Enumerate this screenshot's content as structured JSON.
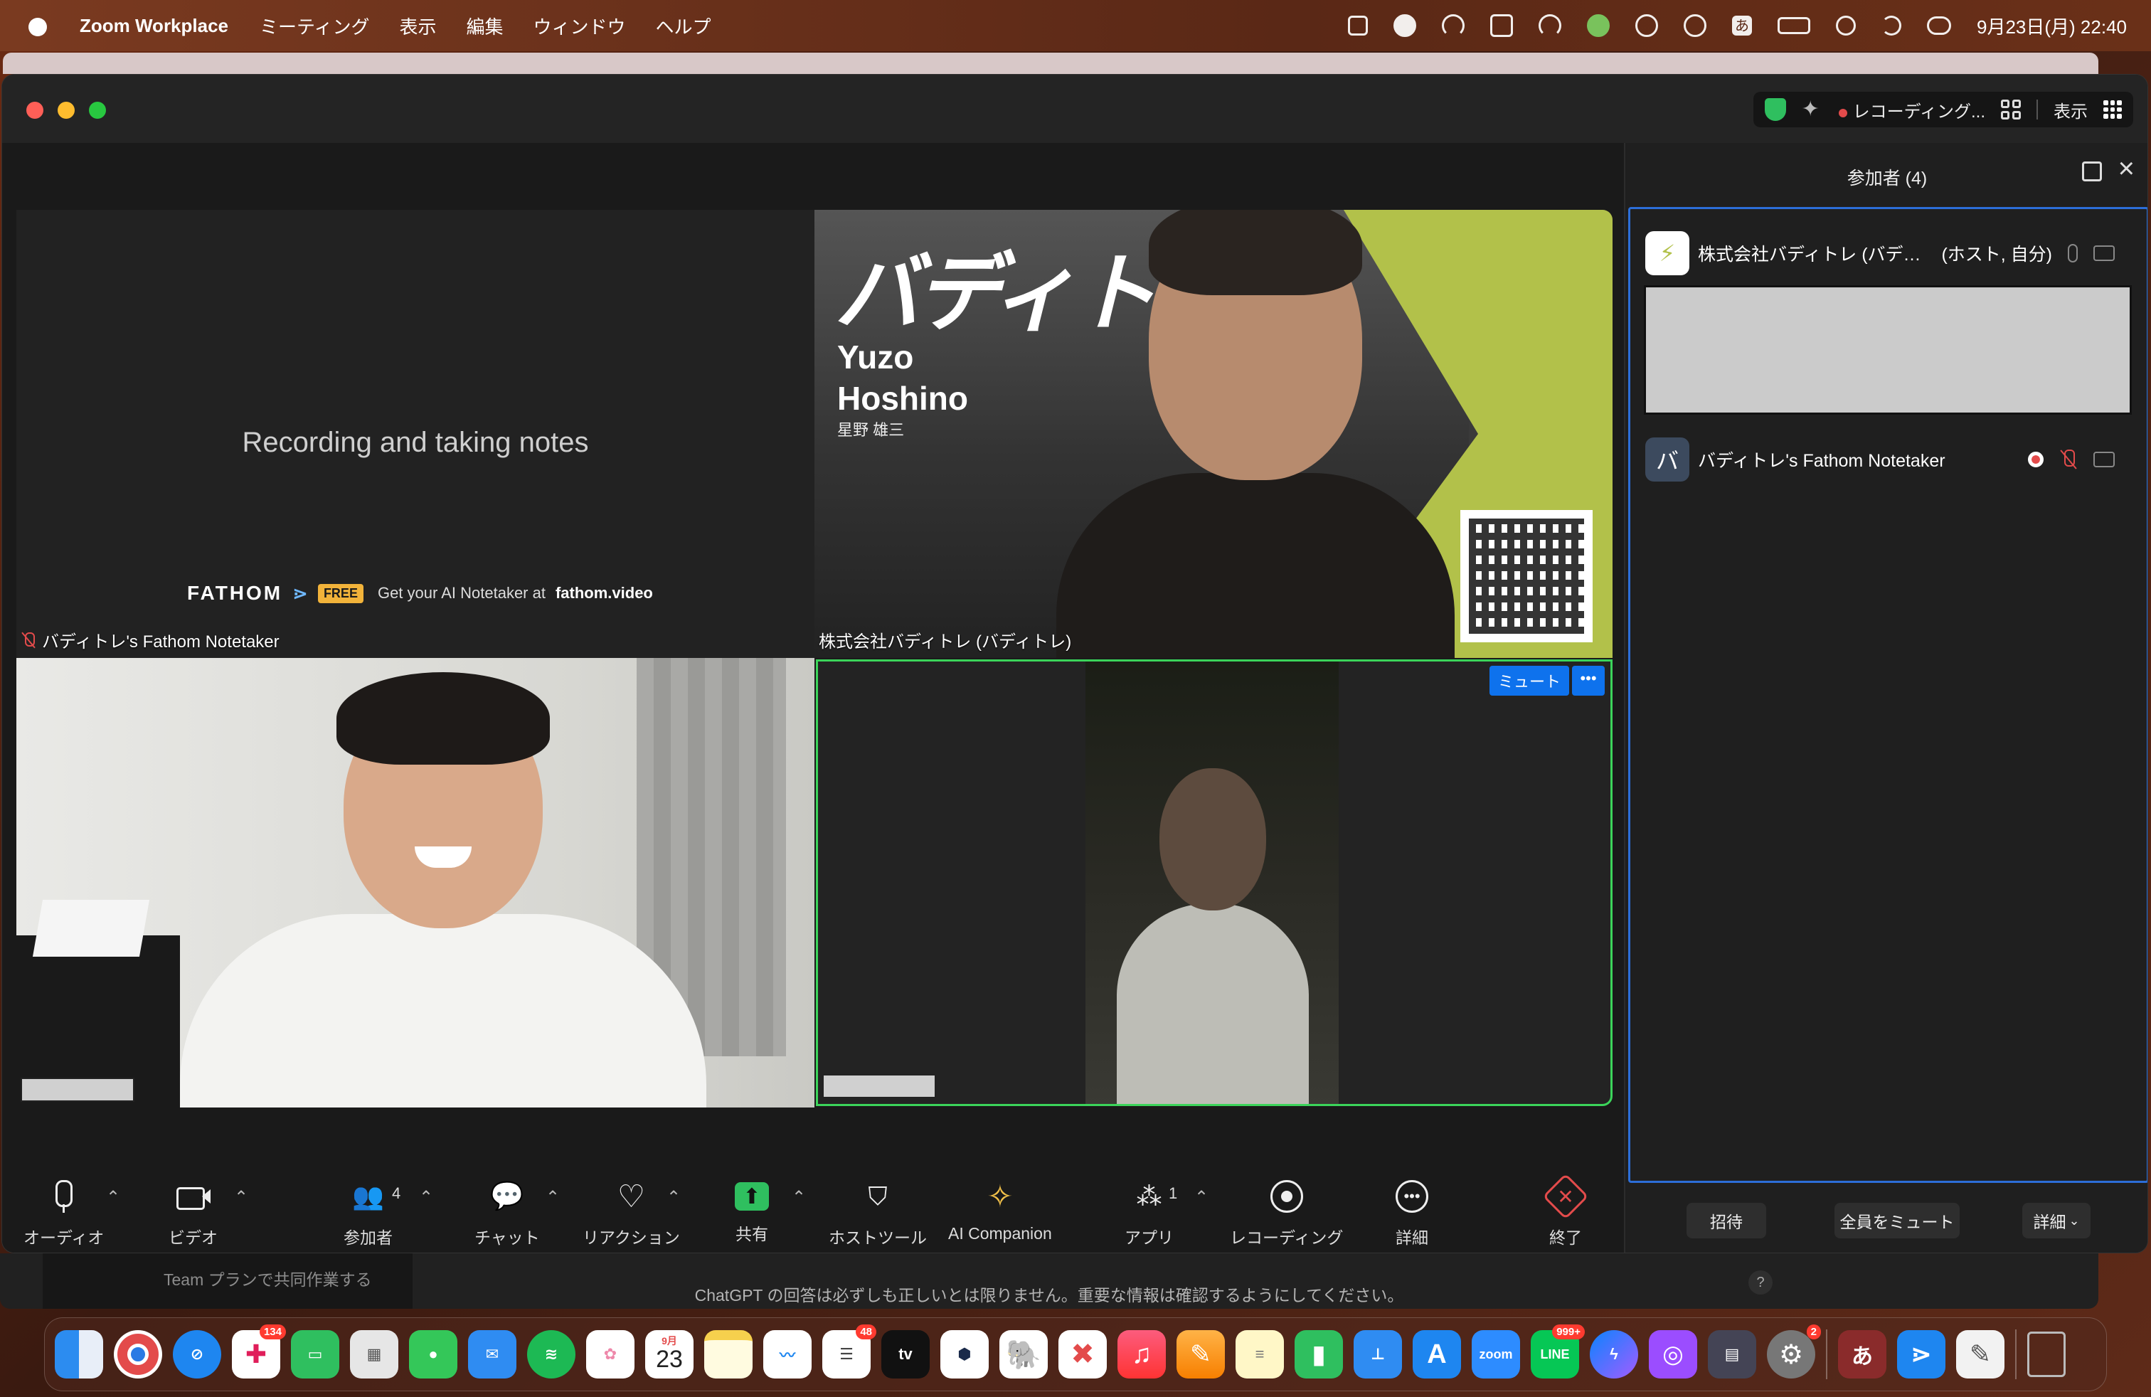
{
  "menubar": {
    "app_name": "Zoom Workplace",
    "menus": [
      "ミーティング",
      "表示",
      "編集",
      "ウィンドウ",
      "ヘルプ"
    ],
    "input_method": "あ",
    "clock": "9月23日(月) 22:40"
  },
  "titlebar": {
    "recording_label": "レコーディング...",
    "view_label": "表示"
  },
  "tiles": {
    "fathom": {
      "message": "Recording and taking notes",
      "logo": "FATHOM",
      "free_badge": "FREE",
      "promo_prefix": "Get your AI Notetaker at",
      "promo_link": "fathom.video",
      "name": "バディトレ's Fathom Notetaker"
    },
    "host": {
      "brand": "バディトレ",
      "display_name_line1": "Yuzo",
      "display_name_line2": "Hoshino",
      "display_name_jp": "星野 雄三",
      "name": "株式会社バディトレ (バディトレ)"
    },
    "active": {
      "mute_label": "ミュート",
      "more_label": "•••"
    }
  },
  "toolbar": {
    "audio": "オーディオ",
    "video": "ビデオ",
    "participants": "参加者",
    "participants_count": "4",
    "chat": "チャット",
    "reactions": "リアクション",
    "share": "共有",
    "host_tools": "ホストツール",
    "ai_companion": "AI Companion",
    "apps": "アプリ",
    "apps_count": "1",
    "recording": "レコーディング",
    "more": "詳細",
    "end": "終了"
  },
  "panel": {
    "title": "参加者 (4)",
    "participants": [
      {
        "name": "株式会社バディトレ (バデ…",
        "role": "(ホスト, 自分)",
        "avatar": "⚡"
      },
      {
        "name": "バディトレ's Fathom Notetaker",
        "role": "",
        "avatar": "バ"
      }
    ],
    "invite": "招待",
    "mute_all": "全員をミュート",
    "more": "詳細"
  },
  "background_window": {
    "team_text": "Team プランで共同作業する",
    "notice": "ChatGPT の回答は必ずしも正しいとは限りません。重要な情報は確認するようにしてください。",
    "help": "?"
  },
  "dock": {
    "badges": {
      "slack": "134",
      "reminders": "48",
      "line": "999+",
      "settings": "2"
    },
    "calendar_month": "9月",
    "calendar_day": "23",
    "tv_label": "tv",
    "zoom_label": "zoom",
    "ime_label": "あ"
  },
  "colors": {
    "zoom_blue": "#0e72ed",
    "active_speaker_green": "#3bd45a",
    "recording_red": "#e34b4b",
    "brand_green": "#b2c14a"
  }
}
